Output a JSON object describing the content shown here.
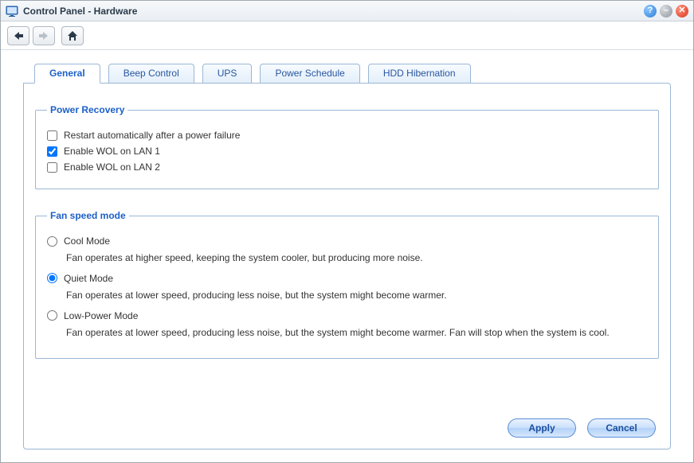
{
  "window": {
    "title": "Control Panel - Hardware"
  },
  "tabs": [
    {
      "label": "General"
    },
    {
      "label": "Beep Control"
    },
    {
      "label": "UPS"
    },
    {
      "label": "Power Schedule"
    },
    {
      "label": "HDD Hibernation"
    }
  ],
  "groups": {
    "power_recovery": {
      "legend": "Power Recovery",
      "options": [
        {
          "label": "Restart automatically after a power failure",
          "checked": false
        },
        {
          "label": "Enable WOL on LAN 1",
          "checked": true
        },
        {
          "label": "Enable WOL on LAN 2",
          "checked": false
        }
      ]
    },
    "fan_speed": {
      "legend": "Fan speed mode",
      "options": [
        {
          "label": "Cool Mode",
          "desc": "Fan operates at higher speed, keeping the system cooler, but producing more noise.",
          "selected": false
        },
        {
          "label": "Quiet Mode",
          "desc": "Fan operates at lower speed, producing less noise, but the system might become warmer.",
          "selected": true
        },
        {
          "label": "Low-Power Mode",
          "desc": "Fan operates at lower speed, producing less noise, but the system might become warmer. Fan will stop when the system is cool.",
          "selected": false
        }
      ]
    }
  },
  "buttons": {
    "apply": "Apply",
    "cancel": "Cancel"
  }
}
